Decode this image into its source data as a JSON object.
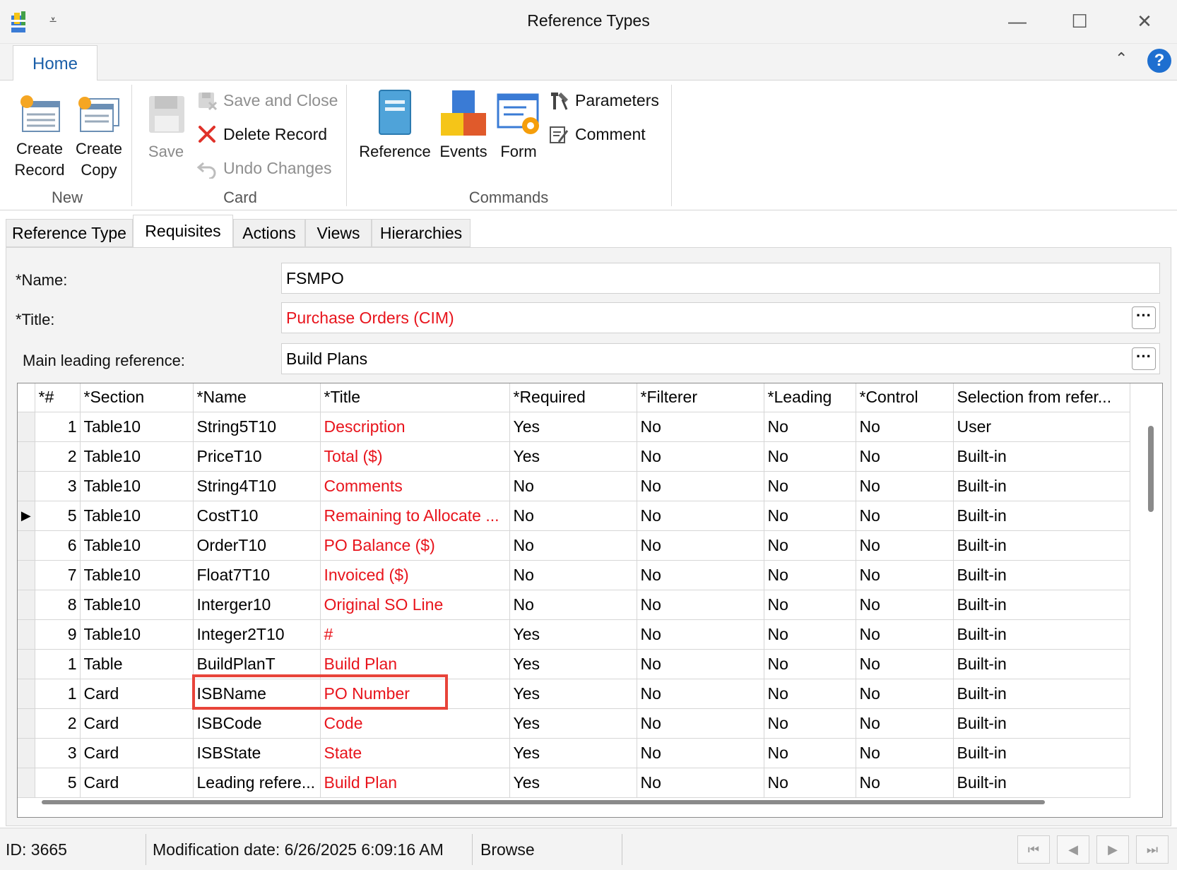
{
  "window": {
    "title": "Reference Types",
    "minimize": "—",
    "maximize": "☐",
    "close": "✕"
  },
  "ribbon": {
    "tab_home": "Home",
    "groups": {
      "new": "New",
      "card": "Card",
      "commands": "Commands"
    },
    "create_record": [
      "Create",
      "Record"
    ],
    "create_copy": [
      "Create",
      "Copy"
    ],
    "save": "Save",
    "save_and_close": "Save and Close",
    "delete_record": "Delete Record",
    "undo_changes": "Undo Changes",
    "reference": "Reference",
    "events": "Events",
    "form": "Form",
    "parameters": "Parameters",
    "comment": "Comment",
    "help": "?"
  },
  "form_tabs": [
    "Reference Type",
    "Requisites",
    "Actions",
    "Views",
    "Hierarchies"
  ],
  "active_form_tab": "Requisites",
  "fields": {
    "name_label": "*Name:",
    "name_value": "FSMPO",
    "title_label": "*Title:",
    "title_value": "Purchase Orders (CIM)",
    "leading_label": "Main leading reference:",
    "leading_value": "Build Plans",
    "dots": "···"
  },
  "grid": {
    "columns": [
      "*#",
      "*Section",
      "*Name",
      "*Title",
      "*Required",
      "*Filterer",
      "*Leading",
      "*Control",
      "Selection from refer..."
    ],
    "rows": [
      [
        "1",
        "Table10",
        "String5T10",
        "Description",
        "Yes",
        "No",
        "No",
        "No",
        "User"
      ],
      [
        "2",
        "Table10",
        "PriceT10",
        "Total ($)",
        "Yes",
        "No",
        "No",
        "No",
        "Built-in"
      ],
      [
        "3",
        "Table10",
        "String4T10",
        "Comments",
        "No",
        "No",
        "No",
        "No",
        "Built-in"
      ],
      [
        "5",
        "Table10",
        "CostT10",
        "Remaining to Allocate ...",
        "No",
        "No",
        "No",
        "No",
        "Built-in"
      ],
      [
        "6",
        "Table10",
        "OrderT10",
        "PO Balance ($)",
        "No",
        "No",
        "No",
        "No",
        "Built-in"
      ],
      [
        "7",
        "Table10",
        "Float7T10",
        "Invoiced ($)",
        "No",
        "No",
        "No",
        "No",
        "Built-in"
      ],
      [
        "8",
        "Table10",
        "Interger10",
        "Original SO Line",
        "No",
        "No",
        "No",
        "No",
        "Built-in"
      ],
      [
        "9",
        "Table10",
        "Integer2T10",
        "#",
        "Yes",
        "No",
        "No",
        "No",
        "Built-in"
      ],
      [
        "1",
        "Table",
        "BuildPlanT",
        "Build Plan",
        "Yes",
        "No",
        "No",
        "No",
        "Built-in"
      ],
      [
        "1",
        "Card",
        "ISBName",
        "PO Number",
        "Yes",
        "No",
        "No",
        "No",
        "Built-in"
      ],
      [
        "2",
        "Card",
        "ISBCode",
        "Code",
        "Yes",
        "No",
        "No",
        "No",
        "Built-in"
      ],
      [
        "3",
        "Card",
        "ISBState",
        "State",
        "Yes",
        "No",
        "No",
        "No",
        "Built-in"
      ],
      [
        "5",
        "Card",
        "Leading refere...",
        "Build Plan",
        "Yes",
        "No",
        "No",
        "No",
        "Built-in"
      ]
    ],
    "current_row_marker": "▶",
    "current_row_index": 3
  },
  "status": {
    "id": "ID: 3665",
    "modification": "Modification date: 6/26/2025 6:09:16 AM",
    "mode": "Browse"
  },
  "colors": {
    "accent_blue": "#1a5ea8",
    "title_red": "#e8141c",
    "highlight": "#e8443a"
  }
}
